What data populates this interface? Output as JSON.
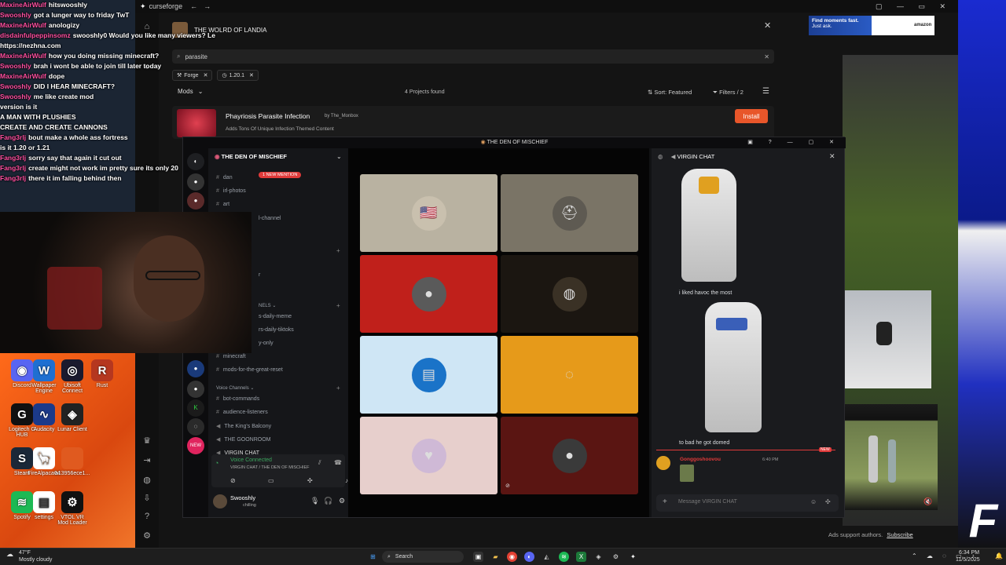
{
  "stream_chat": [
    {
      "user": "MaxineAirWulf",
      "text": "hitswooshly"
    },
    {
      "user": "Swooshly",
      "text": "got a lunger way to friday TwT"
    },
    {
      "user": "MaxineAirWulf",
      "text": "anologizy"
    },
    {
      "user": "disdainfulpeppinsomz",
      "text": "swooshly0 Would you like many viewers? Le"
    },
    {
      "user": "",
      "text": "https://nezhna.com"
    },
    {
      "user": "MaxineAirWulf",
      "text": "how you doing missing minecraft?"
    },
    {
      "user": "Swooshly",
      "text": "brah i wont be able to join till later today"
    },
    {
      "user": "MaxineAirWulf",
      "text": "dope"
    },
    {
      "user": "Swooshly",
      "text": "DID I HEAR MINECRAFT?"
    },
    {
      "user": "Swooshly",
      "text": "me like create mod"
    },
    {
      "user": "",
      "text": "version is it"
    },
    {
      "user": "",
      "text": "A MAN WITH PLUSHIES"
    },
    {
      "user": "",
      "text": "CREATE AND CREATE CANNONS"
    },
    {
      "user": "Fang3rlj",
      "text": "bout make a whole ass fortress"
    },
    {
      "user": "",
      "text": "is it 1.20 or 1.21"
    },
    {
      "user": "Fang3rlj",
      "text": "sorry say that again it cut out"
    },
    {
      "user": "Fang3rlj",
      "text": "create might not work im pretty sure its only 20"
    },
    {
      "user": "Fang3rlj",
      "text": "there it im falling behind then"
    }
  ],
  "desktop_icons": [
    {
      "label": "Discord",
      "icon": "discord-icon",
      "color": "#5865f2",
      "glyph": "◉"
    },
    {
      "label": "Wallpaper Engine",
      "icon": "wallpaper-icon",
      "color": "#1f6fd1",
      "glyph": "W"
    },
    {
      "label": "Ubisoft Connect",
      "icon": "ubisoft-icon",
      "color": "#1a1a2e",
      "glyph": "◎"
    },
    {
      "label": "Rust",
      "icon": "rust-icon",
      "color": "#b5371f",
      "glyph": "R"
    },
    {
      "label": "Logitech G HUB",
      "icon": "logitech-icon",
      "color": "#111",
      "glyph": "G"
    },
    {
      "label": "Audacity",
      "icon": "audacity-icon",
      "color": "#1b3a8a",
      "glyph": "∿"
    },
    {
      "label": "Lunar Client",
      "icon": "lunar-icon",
      "color": "#222",
      "glyph": "◈"
    },
    {
      "label": "Steam",
      "icon": "steam-icon",
      "color": "#1b2838",
      "glyph": "S"
    },
    {
      "label": "FireAlpaca64",
      "icon": "firealpaca-icon",
      "color": "#fff",
      "glyph": "🦙"
    },
    {
      "label": "a13956ece1...",
      "icon": "file-icon",
      "color": "#e05a1f",
      "glyph": ""
    },
    {
      "label": "Spotify",
      "icon": "spotify-icon",
      "color": "#1db954",
      "glyph": "≋"
    },
    {
      "label": "settings",
      "icon": "document-icon",
      "color": "#fff",
      "glyph": "▤"
    },
    {
      "label": "VTOL VR Mod Loader",
      "icon": "gear-icon",
      "color": "#111",
      "glyph": "⚙"
    }
  ],
  "curseforge": {
    "app_name": "curseforge",
    "instance_title": "THE WOLRD OF LANDIA",
    "search_value": "parasite",
    "filters": [
      {
        "label": "Forge"
      },
      {
        "label": "1.20.1"
      }
    ],
    "category": "Mods",
    "results_count": "4 Projects found",
    "sort_label": "Sort: Featured",
    "filters_label": "Filters / 2",
    "project": {
      "name": "Phayriosis Parasite Infection",
      "author": "by The_Monbox",
      "description": "Adds Tons Of Unique Infection Themed Content",
      "install_label": "Install"
    },
    "ad": {
      "line1": "Find moments fast.",
      "line2": "Just ask.",
      "brand": "amazon"
    },
    "support_text": "Ads support authors.",
    "subscribe_label": "Subscribe"
  },
  "discord": {
    "window_title": "THE DEN OF MISCHIEF",
    "server_name": "THE DEN OF MISCHIEF",
    "new_mention": "1 NEW MENTION",
    "channels_top": [
      {
        "name": "dan"
      },
      {
        "name": "irl-photos"
      },
      {
        "name": "art"
      },
      {
        "name": "l-channel"
      },
      {
        "name": "r"
      }
    ],
    "category_channels": "NELS",
    "channels_mid": [
      {
        "name": "s-daily-meme"
      },
      {
        "name": "rs-daily-tiktoks"
      },
      {
        "name": "y-only"
      },
      {
        "name": "minecraft"
      },
      {
        "name": "mods-for-the-great-reset"
      }
    ],
    "voice_category": "Voice Channels",
    "voice_channels": [
      {
        "name": "bot-commands"
      },
      {
        "name": "audience-listeners"
      },
      {
        "name": "The King's Balcony"
      },
      {
        "name": "THE GOONROOM"
      },
      {
        "name": "VIRGIN CHAT"
      }
    ],
    "voice_status": "Voice Connected",
    "voice_location": "VIRGIN CHAT / THE DEN OF MISCHIEF",
    "user": {
      "name": "Swooshly",
      "status": "chilling"
    },
    "new_badge": "NEW",
    "stage_tiles": [
      {
        "bg": "#b9b2a1",
        "avatar_bg": "#c9c0ae",
        "glyph": "🇺🇸"
      },
      {
        "bg": "#7a7466",
        "avatar_bg": "#5e5a52",
        "glyph": "⛑"
      },
      {
        "bg": "#c0201b",
        "avatar_bg": "#5a5a5a",
        "glyph": "●"
      },
      {
        "bg": "#1b1611",
        "avatar_bg": "#3a3125",
        "glyph": "◍"
      },
      {
        "bg": "#cfe6f5",
        "avatar_bg": "#1a73c8",
        "glyph": "▤"
      },
      {
        "bg": "#e69a1a",
        "avatar_bg": "#e69a1a",
        "glyph": "◌"
      },
      {
        "bg": "#e7cfcc",
        "avatar_bg": "#cfb9d6",
        "glyph": "♥"
      },
      {
        "bg": "#5a1512",
        "avatar_bg": "#3a3a3a",
        "glyph": "●"
      }
    ],
    "chat_title": "VIRGIN CHAT",
    "chat_messages": [
      {
        "text": "i liked havoc the most"
      },
      {
        "text": "to bad he got domed"
      }
    ],
    "chat_new_label": "NEW",
    "chat_last_user": "Gonggoshoovou",
    "chat_last_time": "6:40 PM",
    "message_placeholder": "Message  VIRGIN CHAT"
  },
  "taskbar": {
    "weather_temp": "47°F",
    "weather_desc": "Mostly cloudy",
    "search_label": "Search",
    "time": "6:34 PM",
    "date": "11/5/2025"
  }
}
